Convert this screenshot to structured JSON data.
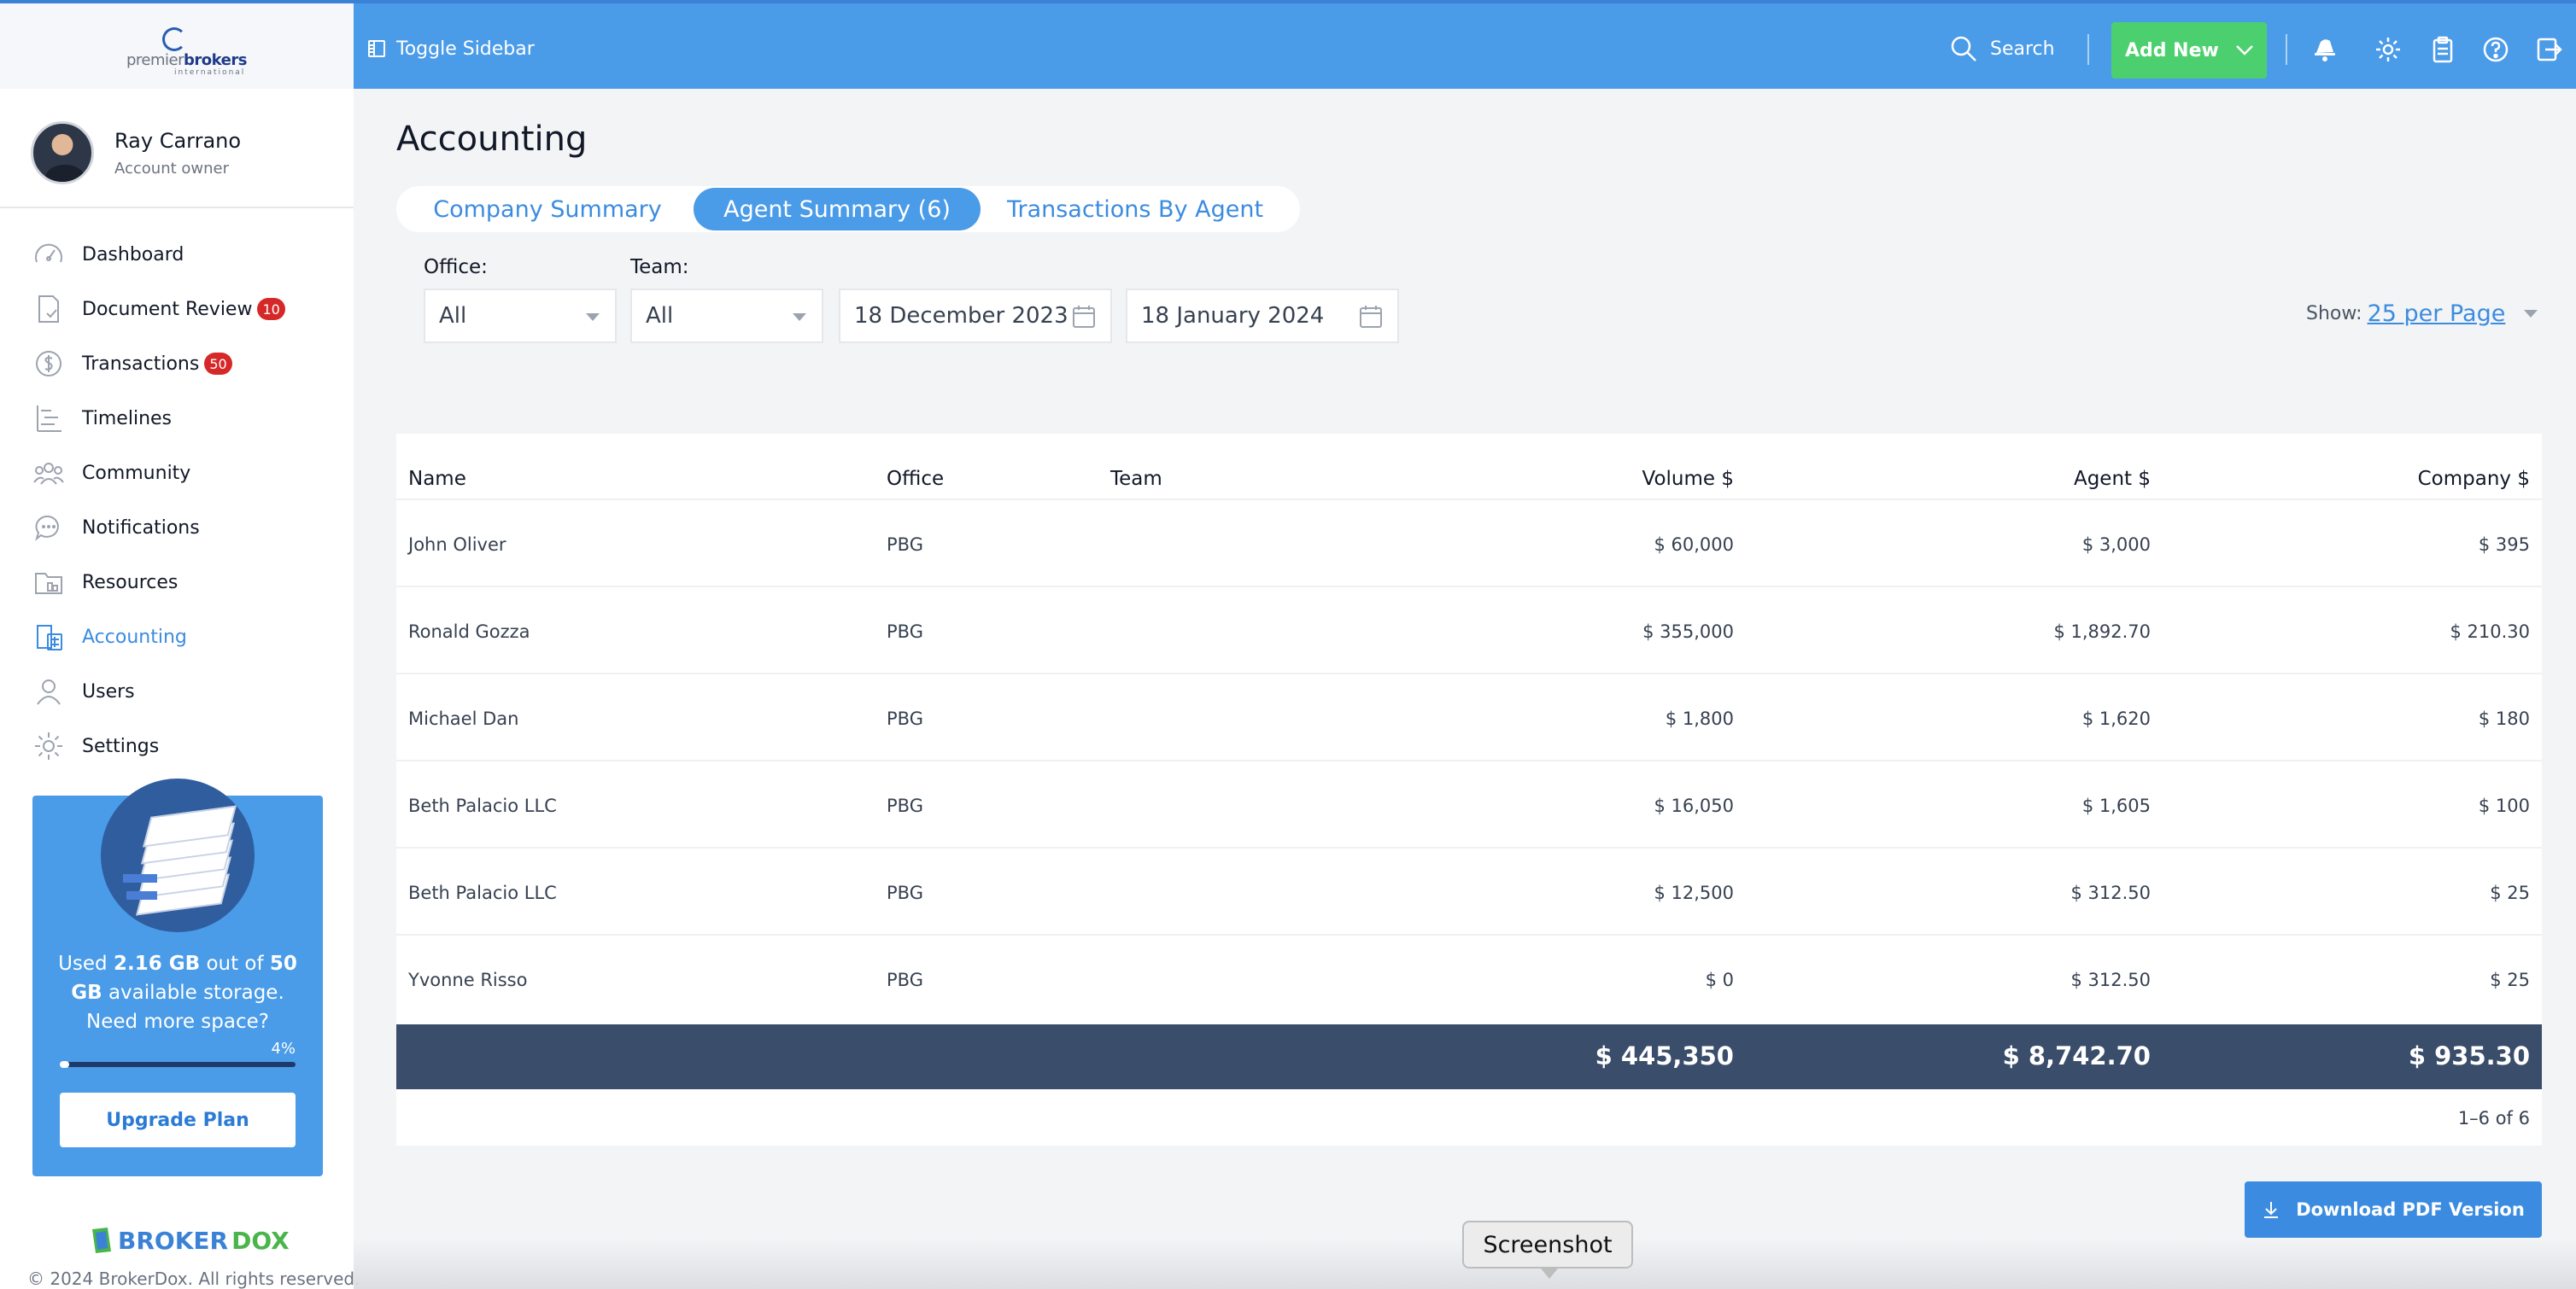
{
  "header": {
    "logo": {
      "part1": "premier",
      "part2": "brokers",
      "sub": "international"
    },
    "toggle_label": "Toggle Sidebar",
    "search_label": "Search",
    "add_new_label": "Add New"
  },
  "user": {
    "name": "Ray Carrano",
    "role": "Account owner"
  },
  "sidebar": {
    "items": [
      {
        "label": "Dashboard",
        "icon": "speedometer-icon"
      },
      {
        "label": "Document Review",
        "icon": "document-check-icon",
        "badge": "10"
      },
      {
        "label": "Transactions",
        "icon": "dollar-coin-icon",
        "badge": "50"
      },
      {
        "label": "Timelines",
        "icon": "timeline-icon"
      },
      {
        "label": "Community",
        "icon": "people-icon"
      },
      {
        "label": "Notifications",
        "icon": "chat-bubble-icon"
      },
      {
        "label": "Resources",
        "icon": "folder-icon"
      },
      {
        "label": "Accounting",
        "icon": "calculator-icon",
        "active": true
      },
      {
        "label": "Users",
        "icon": "user-icon"
      },
      {
        "label": "Settings",
        "icon": "gear-icon"
      }
    ]
  },
  "storage": {
    "used_prefix": "Used",
    "used": "2.16 GB",
    "mid": "out of",
    "total": "50 GB",
    "suffix": "available storage. Need more space?",
    "percent_label": "4%",
    "percent": 4,
    "upgrade_label": "Upgrade Plan"
  },
  "footer": {
    "brand_a": "BROKER",
    "brand_b": "DOX",
    "copyright": "© 2024 BrokerDox. All rights reserved."
  },
  "page": {
    "title": "Accounting"
  },
  "tabs": [
    {
      "label": "Company Summary",
      "active": false
    },
    {
      "label": "Agent Summary (6)",
      "active": true
    },
    {
      "label": "Transactions By Agent",
      "active": false
    }
  ],
  "filters": {
    "office_label": "Office:",
    "office_value": "All",
    "team_label": "Team:",
    "team_value": "All",
    "date_from": "18 December 2023",
    "date_to": "18 January 2024",
    "show_label": "Show:",
    "per_page": "25 per Page"
  },
  "table": {
    "columns": [
      "Name",
      "Office",
      "Team",
      "Volume $",
      "Agent $",
      "Company $"
    ],
    "rows": [
      [
        "John Oliver",
        "PBG",
        "",
        "$ 60,000",
        "$ 3,000",
        "$ 395"
      ],
      [
        "Ronald Gozza",
        "PBG",
        "",
        "$ 355,000",
        "$ 1,892.70",
        "$ 210.30"
      ],
      [
        "Michael Dan",
        "PBG",
        "",
        "$ 1,800",
        "$ 1,620",
        "$ 180"
      ],
      [
        "Beth Palacio LLC",
        "PBG",
        "",
        "$ 16,050",
        "$ 1,605",
        "$ 100"
      ],
      [
        "Beth Palacio LLC",
        "PBG",
        "",
        "$ 12,500",
        "$ 312.50",
        "$ 25"
      ],
      [
        "Yvonne Risso",
        "PBG",
        "",
        "$ 0",
        "$ 312.50",
        "$ 25"
      ]
    ],
    "totals": {
      "volume": "$ 445,350",
      "agent": "$ 8,742.70",
      "company": "$ 935.30"
    },
    "pagination": "1–6 of 6"
  },
  "download_label": "Download PDF Version",
  "tooltip": "Screenshot",
  "colors": {
    "primary": "#4a9be8",
    "accent_green": "#4cd06f",
    "totals_bg": "#3a4d6b",
    "badge": "#d62828"
  }
}
